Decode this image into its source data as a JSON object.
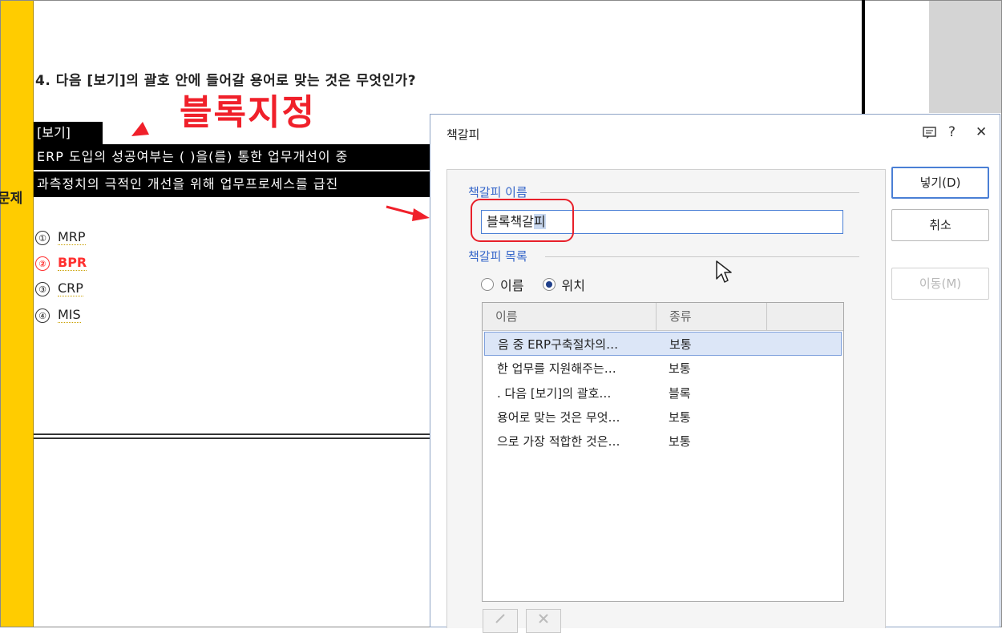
{
  "sidebar": {
    "label": "문제"
  },
  "document": {
    "question": "4. 다음 [보기]의 괄호 안에 들어갈 용어로 맞는 것은 무엇인가?",
    "annotation": "블록지정",
    "box_tag": "[보기]",
    "box_line1": "ERP 도입의 성공여부는 ( )을(를) 통한 업무개선이 중",
    "box_line2": "과측정치의 극적인 개선을 위해 업무프로세스를 급진",
    "options": [
      {
        "num": "①",
        "text": "MRP"
      },
      {
        "num": "②",
        "text": "BPR"
      },
      {
        "num": "③",
        "text": "CRP"
      },
      {
        "num": "④",
        "text": "MIS"
      }
    ]
  },
  "dialog": {
    "title": "책갈피",
    "name_label": "책갈피 이름",
    "name_value_a": "블록책갈",
    "name_value_b": "피",
    "list_label": "책갈피 목록",
    "radio_name": "이름",
    "radio_position": "위치",
    "col_name": "이름",
    "col_type": "종류",
    "rows": [
      {
        "name": "음 중 ERP구축절차의…",
        "type": "보통"
      },
      {
        "name": "한 업무를 지원해주는…",
        "type": "보통"
      },
      {
        "name": ". 다음 [보기]의 괄호…",
        "type": "블록"
      },
      {
        "name": "용어로 맞는 것은 무엇…",
        "type": "보통"
      },
      {
        "name": "으로 가장 적합한 것은…",
        "type": "보통"
      }
    ],
    "btn_insert": "넣기(D)",
    "btn_cancel": "취소",
    "btn_move": "이동(M)"
  }
}
